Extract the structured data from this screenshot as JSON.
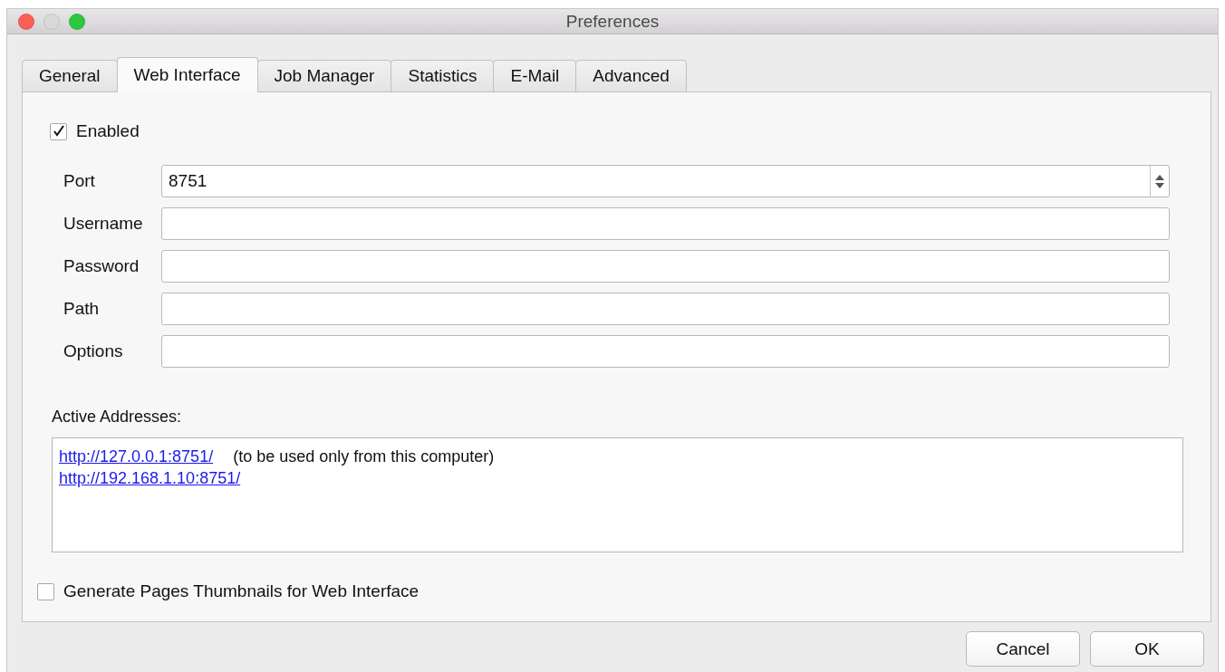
{
  "window": {
    "title": "Preferences"
  },
  "tabs": [
    {
      "label": "General",
      "selected": false
    },
    {
      "label": "Web Interface",
      "selected": true
    },
    {
      "label": "Job Manager",
      "selected": false
    },
    {
      "label": "Statistics",
      "selected": false
    },
    {
      "label": "E-Mail",
      "selected": false
    },
    {
      "label": "Advanced",
      "selected": false
    }
  ],
  "enabled": {
    "label": "Enabled",
    "checked": true
  },
  "fields": [
    {
      "label": "Port",
      "value": "8751",
      "kind": "spinner"
    },
    {
      "label": "Username",
      "kind": "text"
    },
    {
      "label": "Password",
      "kind": "text"
    },
    {
      "label": "Path",
      "kind": "text"
    },
    {
      "label": "Options",
      "kind": "text"
    }
  ],
  "active_addresses": {
    "label": "Active Addresses:",
    "lines": [
      {
        "link": "http://127.0.0.1:8751/",
        "note": "(to be used only from this computer)"
      },
      {
        "link": "http://192.168.1.10:8751/"
      }
    ]
  },
  "thumbnails": {
    "label": "Generate Pages Thumbnails for Web Interface",
    "checked": false
  },
  "buttons": [
    "Cancel",
    "OK"
  ]
}
